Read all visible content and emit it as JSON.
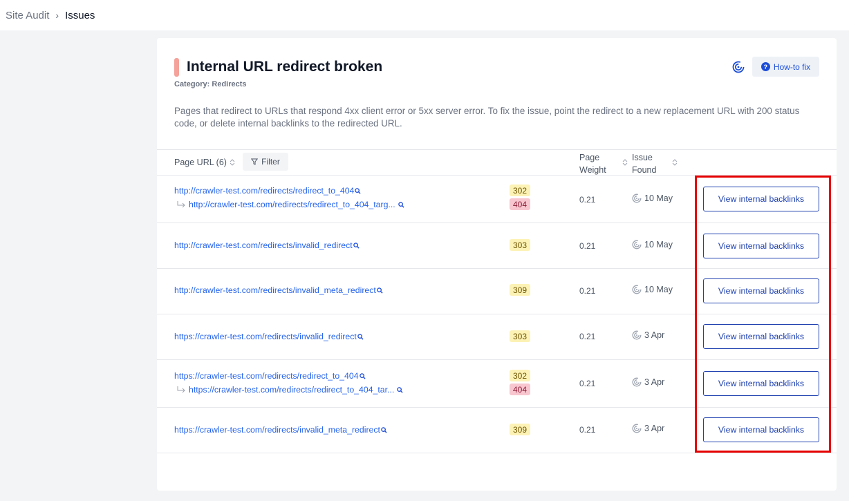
{
  "breadcrumb": {
    "root": "Site Audit",
    "separator": "›",
    "current": "Issues"
  },
  "issue": {
    "title": "Internal URL redirect broken",
    "category": "Category: Redirects",
    "description": "Pages that redirect to URLs that respond 4xx client error or 5xx server error. To fix the issue, point the redirect to a new replacement URL with 200 status code, or delete internal backlinks to the redirected URL.",
    "howto_label": "How-to fix",
    "howto_icon": "?"
  },
  "table": {
    "col_url": "Page URL (6)",
    "filter_label": "Filter",
    "col_weight_1": "Page",
    "col_weight_2": "Weight",
    "col_found_1": "Issue",
    "col_found_2": "Found",
    "rows": [
      {
        "url": "http://crawler-test.com/redirects/redirect_to_404",
        "target": "http://crawler-test.com/redirects/redirect_to_404_targ...",
        "code1": "302",
        "code2": "404",
        "weight": "0.21",
        "found": "10 May",
        "action": "View internal backlinks"
      },
      {
        "url": "http://crawler-test.com/redirects/invalid_redirect",
        "code1": "303",
        "weight": "0.21",
        "found": "10 May",
        "action": "View internal backlinks"
      },
      {
        "url": "http://crawler-test.com/redirects/invalid_meta_redirect",
        "code1": "309",
        "weight": "0.21",
        "found": "10 May",
        "action": "View internal backlinks"
      },
      {
        "url": "https://crawler-test.com/redirects/invalid_redirect",
        "code1": "303",
        "weight": "0.21",
        "found": "3 Apr",
        "action": "View internal backlinks"
      },
      {
        "url": "https://crawler-test.com/redirects/redirect_to_404",
        "target": "https://crawler-test.com/redirects/redirect_to_404_tar...",
        "code1": "302",
        "code2": "404",
        "weight": "0.21",
        "found": "3 Apr",
        "action": "View internal backlinks"
      },
      {
        "url": "https://crawler-test.com/redirects/invalid_meta_redirect",
        "code1": "309",
        "weight": "0.21",
        "found": "3 Apr",
        "action": "View internal backlinks"
      }
    ]
  },
  "colors": {
    "accent": "#1e40af",
    "link": "#2563eb",
    "severity_bar": "#f4a29a",
    "badge_3xx": "#fdf2b5",
    "badge_4xx": "#f8c6cf",
    "highlight": "#e60000"
  }
}
